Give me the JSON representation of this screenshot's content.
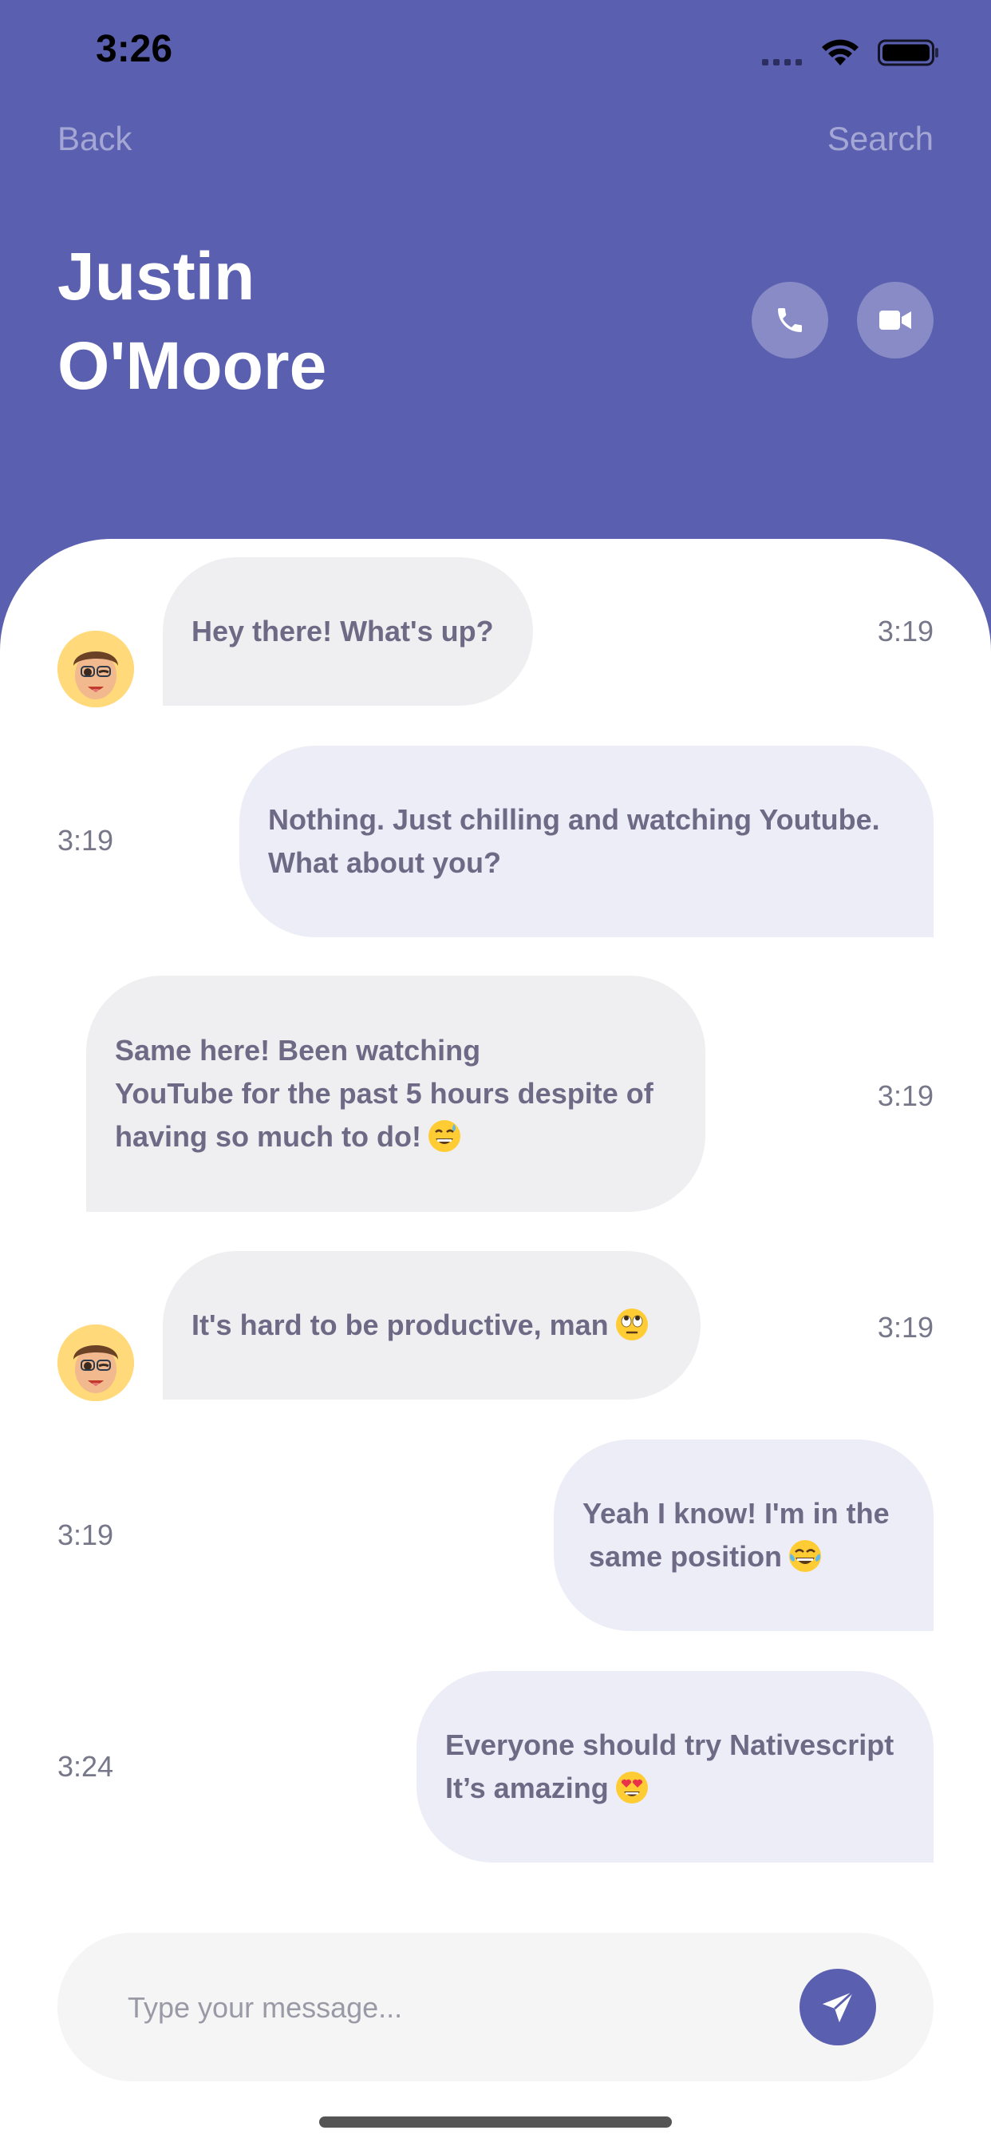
{
  "status_bar": {
    "time": "3:26"
  },
  "nav": {
    "back_label": "Back",
    "search_label": "Search"
  },
  "contact": {
    "name_line1": "Justin",
    "name_line2": "O'Moore"
  },
  "messages": [
    {
      "direction": "incoming",
      "lines": [
        "Hey there! What's up?"
      ],
      "time": "3:19",
      "has_avatar": true
    },
    {
      "direction": "outgoing",
      "lines": [
        "Nothing. Just chilling and watching Youtube.",
        "What about you?"
      ],
      "time": "3:19"
    },
    {
      "direction": "incoming",
      "lines": [
        "Same here! Been watching",
        "YouTube for the past 5 hours despite of",
        "having so much to do!"
      ],
      "time": "3:19",
      "emoji": "sweat-smile",
      "has_avatar": false
    },
    {
      "direction": "incoming",
      "lines": [
        "It's hard to be productive, man"
      ],
      "time": "3:19",
      "emoji": "eye-roll",
      "has_avatar": true
    },
    {
      "direction": "outgoing",
      "lines": [
        "Yeah I know! I'm in the",
        "same position"
      ],
      "time": "3:19",
      "emoji": "tears-of-joy"
    },
    {
      "direction": "outgoing",
      "lines": [
        "Everyone should try Nativescript",
        "It’s amazing"
      ],
      "time": "3:24",
      "emoji": "heart-eyes"
    }
  ],
  "composer": {
    "placeholder": "Type your message..."
  },
  "icons": {
    "call": "phone-icon",
    "video": "video-camera-icon",
    "send": "paper-plane-icon"
  },
  "colors": {
    "accent": "#5a5fb0",
    "incoming_bubble": "#efeff1",
    "outgoing_bubble": "#ededf7",
    "message_text": "#6e6a86"
  }
}
